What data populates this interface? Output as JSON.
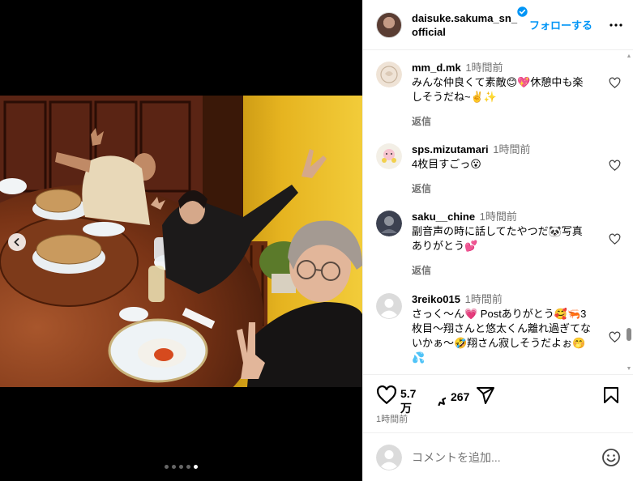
{
  "post": {
    "author": "daisuke.sakuma_sn_official",
    "author_line1": "daisuke.sakuma_sn_",
    "author_line2": "official",
    "follow_label": "フォローする",
    "likes_line1": "5.7",
    "likes_line2": "万",
    "comment_count": "267",
    "time": "1時間前"
  },
  "carousel": {
    "total": 5,
    "current": 5
  },
  "comments": [
    {
      "user": "mm_d.mk",
      "time": "1時間前",
      "text": "みんな仲良くて素敵😊💖休憩中も楽しそうだね~✌️✨",
      "reply": "返信",
      "avatar": "light-avatar"
    },
    {
      "user": "sps.mizutamari",
      "time": "1時間前",
      "text": "4枚目すごっ😮",
      "reply": "返信",
      "avatar": "flower-avatar"
    },
    {
      "user": "saku__chine",
      "time": "1時間前",
      "text": "副音声の時に話してたやつだ🐼写真ありがとう💕",
      "reply": "返信",
      "avatar": "dark-avatar"
    },
    {
      "user": "3reiko015",
      "time": "1時間前",
      "text": "さっく〜ん💗 Postありがとう🥰🦐3枚目〜翔さんと悠太くん離れ過ぎてないかぁ〜🤣翔さん寂しそうだよぉ🤭💦",
      "reply": "",
      "avatar": "default-avatar"
    }
  ],
  "composer": {
    "placeholder": "コメントを追加..."
  },
  "colors": {
    "accent": "#0095f6",
    "muted": "#737373",
    "divider": "#efefef"
  },
  "icons": [
    "verified-badge-icon",
    "more-options-icon",
    "heart-icon",
    "comment-icon",
    "share-icon",
    "bookmark-icon",
    "emoji-icon",
    "chevron-left-icon"
  ]
}
